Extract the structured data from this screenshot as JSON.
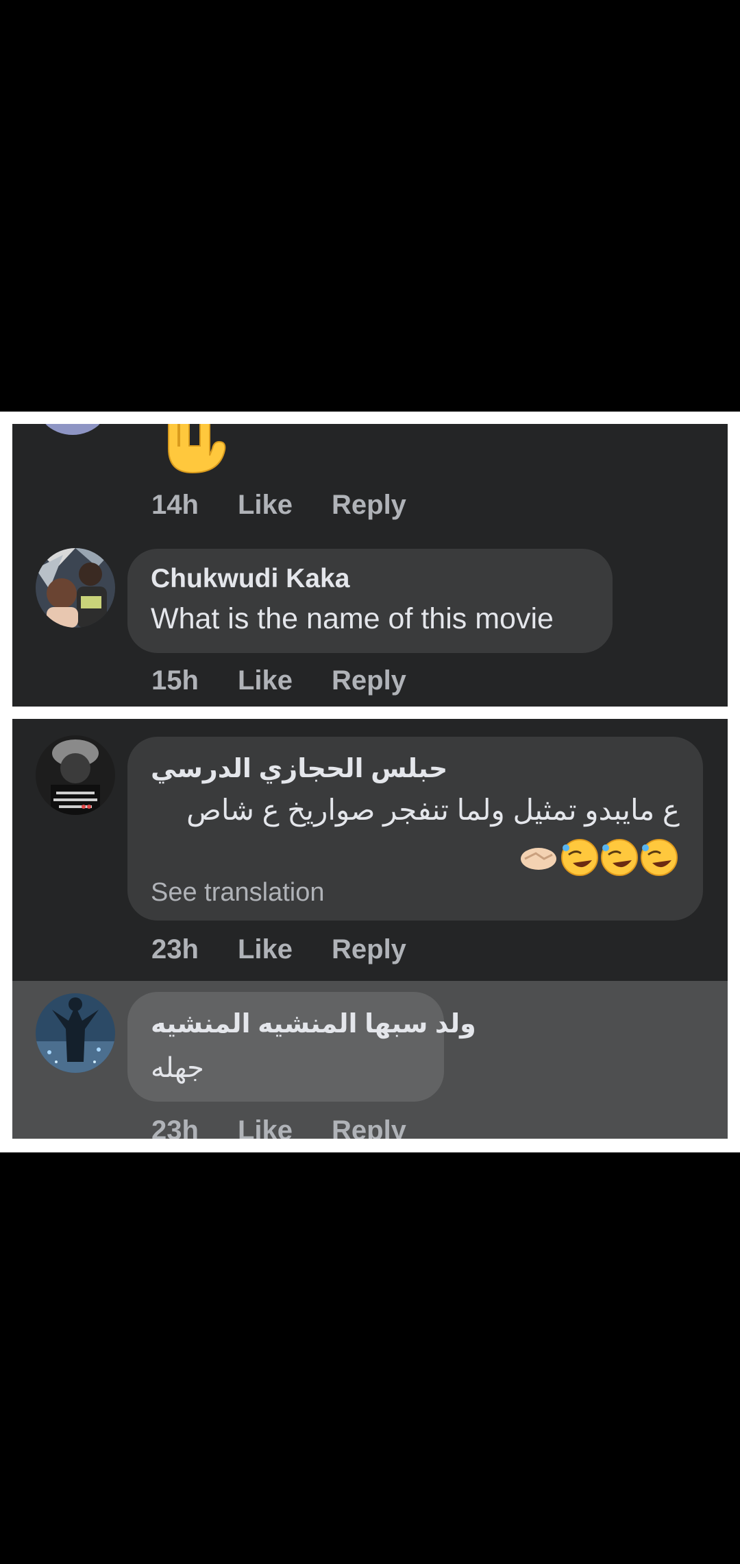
{
  "comments": [
    {
      "reaction_emoji": "🤟",
      "time": "14h",
      "like_label": "Like",
      "reply_label": "Reply"
    },
    {
      "author": "Chukwudi Kaka",
      "text": "What is the name of this movie",
      "time": "15h",
      "like_label": "Like",
      "reply_label": "Reply"
    },
    {
      "author": "حبلس الحجازي الدرسي",
      "text": "ع مايبدو تمثيل ولما تنفجر صواريخ ع شاص",
      "emoji_line": "🤝🤣🤣🤣",
      "see_translation_label": "See translation",
      "time": "23h",
      "like_label": "Like",
      "reply_label": "Reply"
    },
    {
      "author": "ولد سبها المنشيه المنشيه",
      "text": "جهله",
      "time": "23h",
      "like_label": "Like",
      "reply_label": "Reply"
    }
  ],
  "colors": {
    "background": "#000000",
    "frame": "#ffffff",
    "panel": "#242526",
    "bubble": "#3a3b3c",
    "highlight": "#4e4f50",
    "primary_text": "#e4e6eb",
    "secondary_text": "#b0b3b8"
  }
}
